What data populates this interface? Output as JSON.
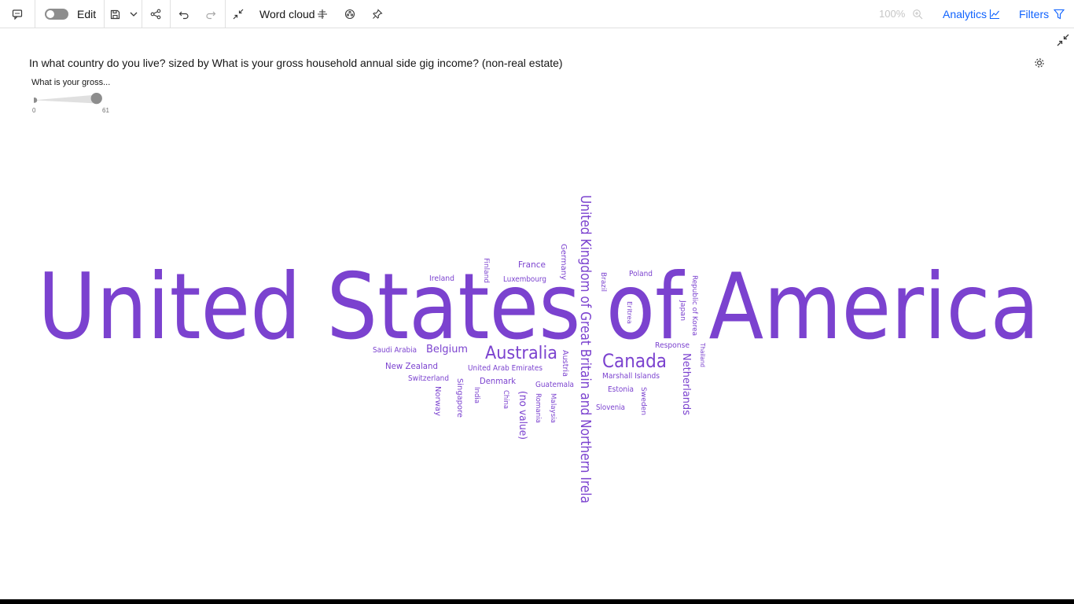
{
  "toolbar": {
    "edit_label": "Edit",
    "chart_type_label": "Word cloud",
    "zoom": "100%",
    "analytics_label": "Analytics",
    "filters_label": "Filters"
  },
  "visualization": {
    "title": "In what country do you live? sized by What is your gross household annual side gig income? (non-real estate)",
    "slider": {
      "label": "What is your gross...",
      "min": "0",
      "max": "61"
    }
  },
  "colors": {
    "word": "#7b42cf",
    "accent": "#0f62fe"
  },
  "chart_data": {
    "type": "wordcloud",
    "title": "",
    "words": [
      {
        "text": "United States of America"
      },
      {
        "text": "United Kingdom of Great Britain and Northern Irela"
      },
      {
        "text": "Canada"
      },
      {
        "text": "Australia"
      },
      {
        "text": "Belgium"
      },
      {
        "text": "Netherlands"
      },
      {
        "text": "France"
      },
      {
        "text": "(no value)"
      },
      {
        "text": "New Zealand"
      },
      {
        "text": "Denmark"
      },
      {
        "text": "Germany"
      },
      {
        "text": "Finland"
      },
      {
        "text": "Ireland"
      },
      {
        "text": "Luxembourg"
      },
      {
        "text": "Brazil"
      },
      {
        "text": "Poland"
      },
      {
        "text": "Eritrea"
      },
      {
        "text": "Japan"
      },
      {
        "text": "Republic of Korea"
      },
      {
        "text": "Thailand"
      },
      {
        "text": "Response"
      },
      {
        "text": "Saudi Arabia"
      },
      {
        "text": "United Arab Emirates"
      },
      {
        "text": "Austria"
      },
      {
        "text": "Marshall Islands"
      },
      {
        "text": "Switzerland"
      },
      {
        "text": "Guatemala"
      },
      {
        "text": "Estonia"
      },
      {
        "text": "Sweden"
      },
      {
        "text": "Slovenia"
      },
      {
        "text": "Norway"
      },
      {
        "text": "Singapore"
      },
      {
        "text": "India"
      },
      {
        "text": "China"
      },
      {
        "text": "Romania"
      },
      {
        "text": "Malaysia"
      }
    ]
  }
}
